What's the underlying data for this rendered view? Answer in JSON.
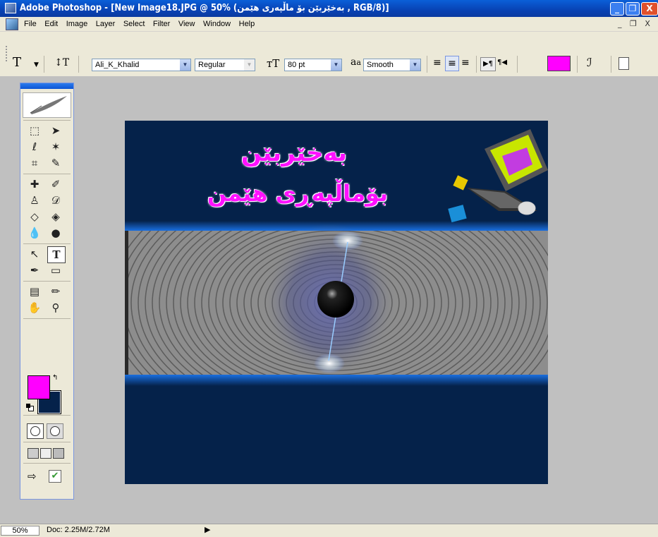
{
  "window": {
    "title": "Adobe Photoshop - [New Image18.JPG @ 50% (بەخێربێن بۆ ماڵپەری هێمن , RGB/8)]",
    "title_display": "Adobe Photoshop - [New Image18.JPG @ 50% (بەخێربێن بۆ ماڵپەری هێمن , RGB/8)]",
    "minimize_glyph": "_",
    "restore_glyph": "❐",
    "close_glyph": "X"
  },
  "menu": {
    "items": [
      "File",
      "Edit",
      "Image",
      "Layer",
      "Select",
      "Filter",
      "View",
      "Window",
      "Help"
    ],
    "doc_controls": "_ ❐ X"
  },
  "options": {
    "tool_glyph": "T",
    "font_family": "Ali_K_Khalid",
    "font_style": "Regular",
    "font_size": "80 pt",
    "antialias": "Smooth",
    "aa_glyph": "a",
    "text_color": "#ff00ff"
  },
  "toolbox": {
    "foreground_color": "#ff00ff",
    "background_color": "#05224a"
  },
  "canvas": {
    "headline_line1": "بەخێربێن",
    "headline_line2": "بۆماڵپەڕی هێمن",
    "headline_color": "#ff10ff",
    "background_color": "#05224a"
  },
  "status": {
    "zoom": "50%",
    "doc_info": "Doc: 2.25M/2.72M",
    "arrow_glyph": "▶"
  }
}
